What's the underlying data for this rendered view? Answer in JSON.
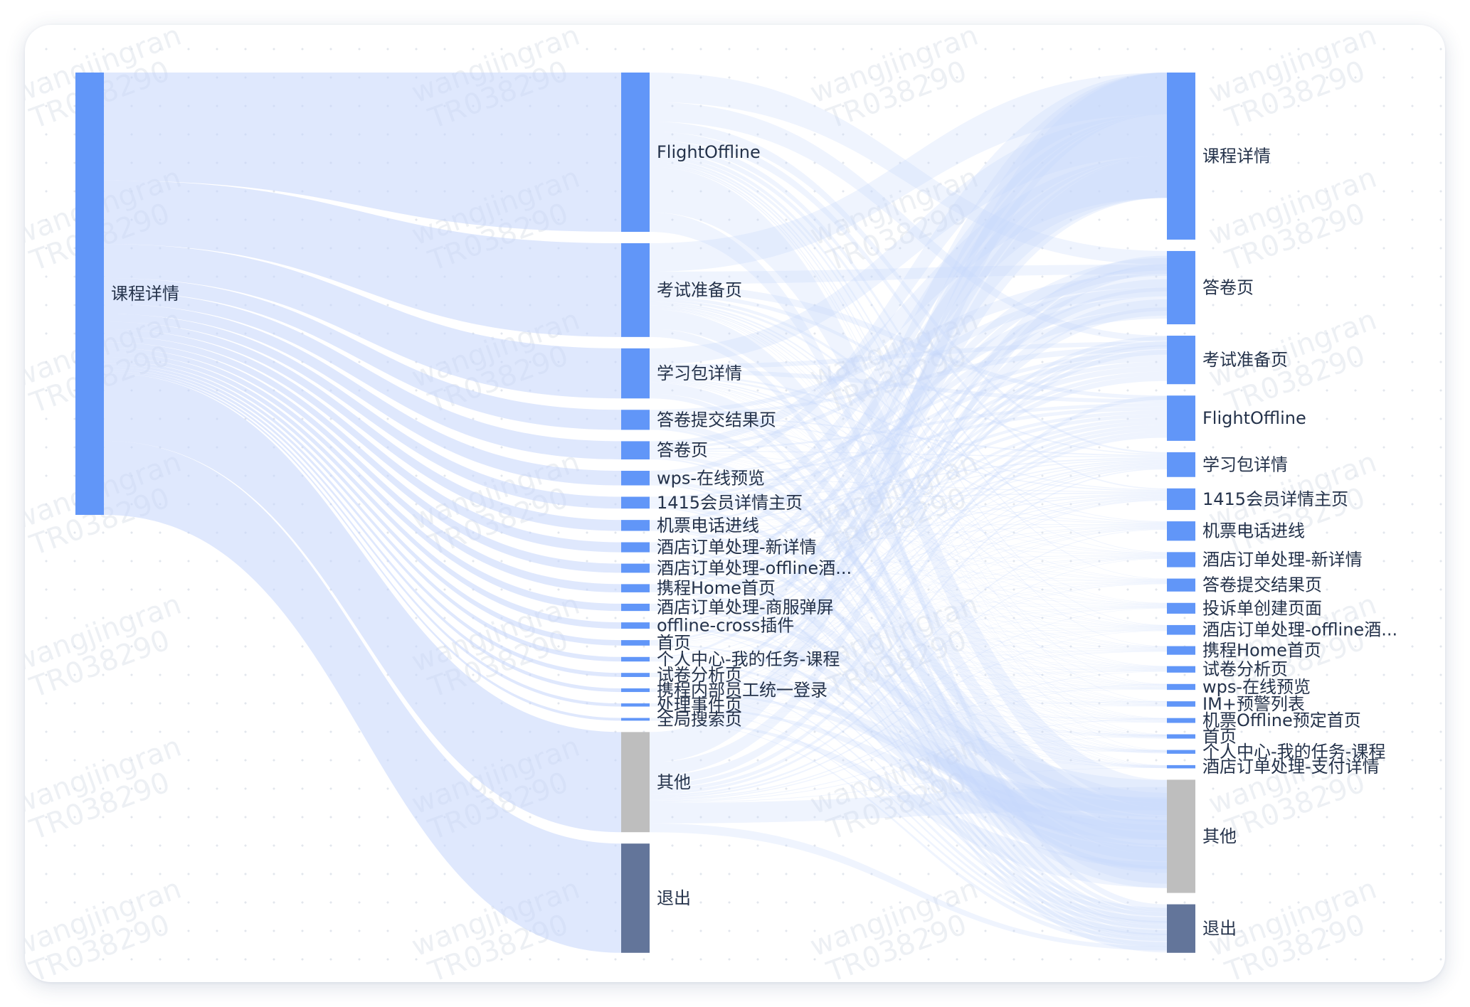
{
  "watermark": {
    "line1": "wangjingran",
    "line2": "TR038290"
  },
  "colors": {
    "node": "#6196f8",
    "other": "#bebebe",
    "exit": "#63759a",
    "link": "#c5d6fb",
    "label": "#24324a"
  },
  "chart_data": {
    "type": "sankey",
    "columns": [
      {
        "nodes": [
          {
            "label": "课程详情",
            "value": 72,
            "kind": "page"
          }
        ]
      },
      {
        "nodes": [
          {
            "label": "FlightOffline",
            "value": 17.5,
            "kind": "page"
          },
          {
            "label": "考试准备页",
            "value": 10.3,
            "kind": "page"
          },
          {
            "label": "学习包详情",
            "value": 5.5,
            "kind": "page"
          },
          {
            "label": "答卷提交结果页",
            "value": 2.2,
            "kind": "page"
          },
          {
            "label": "答卷页",
            "value": 2.0,
            "kind": "page"
          },
          {
            "label": "wps-在线预览",
            "value": 1.6,
            "kind": "page"
          },
          {
            "label": "1415会员详情主页",
            "value": 1.3,
            "kind": "page"
          },
          {
            "label": "机票电话进线",
            "value": 1.2,
            "kind": "page"
          },
          {
            "label": "酒店订单处理-新详情",
            "value": 1.1,
            "kind": "page"
          },
          {
            "label": "酒店订单处理-offline酒...",
            "value": 1.0,
            "kind": "page"
          },
          {
            "label": "携程Home首页",
            "value": 0.9,
            "kind": "page"
          },
          {
            "label": "酒店订单处理-商服弹屏",
            "value": 0.8,
            "kind": "page"
          },
          {
            "label": "offline-cross插件",
            "value": 0.7,
            "kind": "page"
          },
          {
            "label": "首页",
            "value": 0.6,
            "kind": "page"
          },
          {
            "label": "个人中心-我的任务-课程",
            "value": 0.5,
            "kind": "page"
          },
          {
            "label": "试卷分析页",
            "value": 0.45,
            "kind": "page"
          },
          {
            "label": "携程内部员工统一登录",
            "value": 0.4,
            "kind": "page"
          },
          {
            "label": "处理事件页",
            "value": 0.35,
            "kind": "page"
          },
          {
            "label": "全局搜索页",
            "value": 0.3,
            "kind": "page"
          },
          {
            "label": "其他",
            "value": 11.0,
            "kind": "other"
          },
          {
            "label": "退出",
            "value": 12.0,
            "kind": "exit"
          }
        ]
      },
      {
        "nodes": [
          {
            "label": "课程详情",
            "value": 15.5,
            "kind": "page"
          },
          {
            "label": "答卷页",
            "value": 6.8,
            "kind": "page"
          },
          {
            "label": "考试准备页",
            "value": 4.5,
            "kind": "page"
          },
          {
            "label": "FlightOffline",
            "value": 4.2,
            "kind": "page"
          },
          {
            "label": "学习包详情",
            "value": 2.3,
            "kind": "page"
          },
          {
            "label": "1415会员详情主页",
            "value": 2.0,
            "kind": "page"
          },
          {
            "label": "机票电话进线",
            "value": 1.8,
            "kind": "page"
          },
          {
            "label": "酒店订单处理-新详情",
            "value": 1.4,
            "kind": "page"
          },
          {
            "label": "答卷提交结果页",
            "value": 1.2,
            "kind": "page"
          },
          {
            "label": "投诉单创建页面",
            "value": 1.0,
            "kind": "page"
          },
          {
            "label": "酒店订单处理-offline酒...",
            "value": 0.9,
            "kind": "page"
          },
          {
            "label": "携程Home首页",
            "value": 0.8,
            "kind": "page"
          },
          {
            "label": "试卷分析页",
            "value": 0.6,
            "kind": "page"
          },
          {
            "label": "wps-在线预览",
            "value": 0.55,
            "kind": "page"
          },
          {
            "label": "IM+预警列表",
            "value": 0.5,
            "kind": "page"
          },
          {
            "label": "机票Offline预定首页",
            "value": 0.45,
            "kind": "page"
          },
          {
            "label": "首页",
            "value": 0.4,
            "kind": "page"
          },
          {
            "label": "个人中心-我的任务-课程",
            "value": 0.35,
            "kind": "page"
          },
          {
            "label": "酒店订单处理-支付详情",
            "value": 0.3,
            "kind": "page"
          },
          {
            "label": "其他",
            "value": 10.5,
            "kind": "other"
          },
          {
            "label": "退出",
            "value": 4.5,
            "kind": "exit"
          }
        ]
      }
    ]
  }
}
